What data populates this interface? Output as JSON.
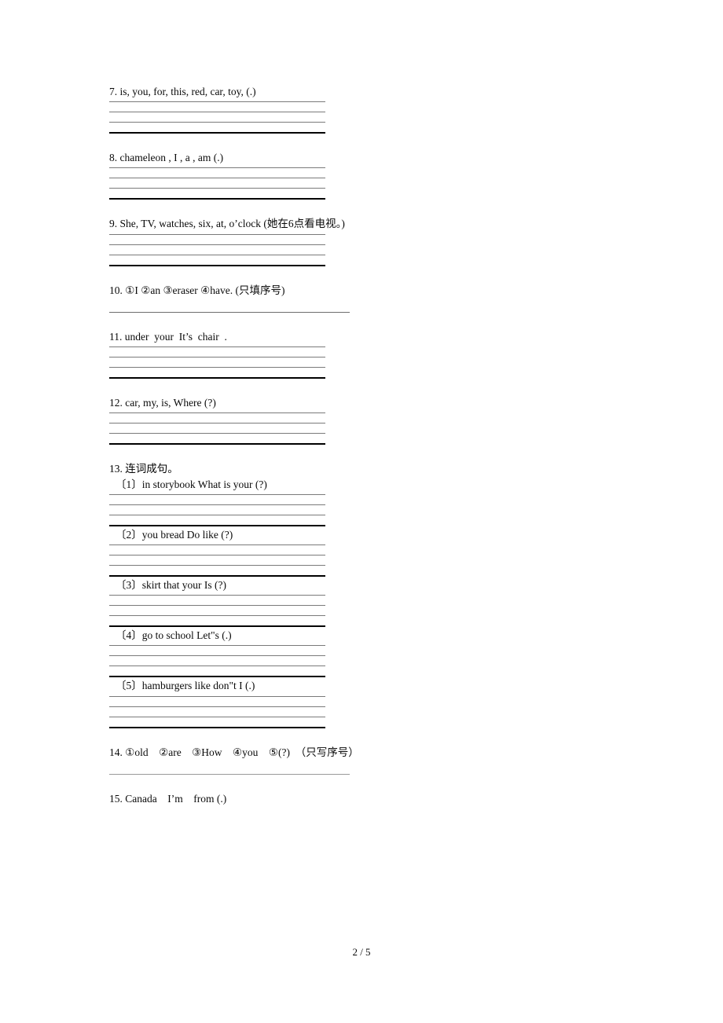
{
  "page": {
    "footer": "2 / 5"
  },
  "questions": [
    {
      "id": "q7",
      "text": "7. is, you, for, this, red, car, toy, (.)",
      "rule_style": "block4"
    },
    {
      "id": "q8",
      "text": "8. chameleon , I , a , am (.)",
      "rule_style": "block4"
    },
    {
      "id": "q9",
      "text": "9. She, TV, watches, six, at, o’clock (她在6点看电视。)",
      "rule_style": "block4"
    },
    {
      "id": "q10",
      "text": "10. ①I ②an ③eraser ④have. (只填序号)",
      "rule_style": "single-wide"
    },
    {
      "id": "q11",
      "text": "11. under  your  It’s  chair  .",
      "rule_style": "block4"
    },
    {
      "id": "q12",
      "text": "12. car, my, is, Where (?)",
      "rule_style": "block4"
    }
  ],
  "section13": {
    "heading": "13. 连词成句。",
    "items": [
      {
        "id": "s13-1",
        "text": "〔1〕in storybook What is your (?)"
      },
      {
        "id": "s13-2",
        "text": "〔2〕you bread Do like (?)"
      },
      {
        "id": "s13-3",
        "text": "〔3〕skirt that your Is (?)"
      },
      {
        "id": "s13-4",
        "text": "〔4〕go to school Let\"s (.)"
      },
      {
        "id": "s13-5",
        "text": "〔5〕hamburgers like don\"t I (.)"
      }
    ]
  },
  "questions_tail": [
    {
      "id": "q14",
      "text": "14. ①old　②are　③How　④you　⑤(?)　（只写序号）",
      "rule_style": "single-wide-light"
    },
    {
      "id": "q15",
      "text": "15. Canada　I’m　from (.)",
      "rule_style": "none"
    }
  ]
}
